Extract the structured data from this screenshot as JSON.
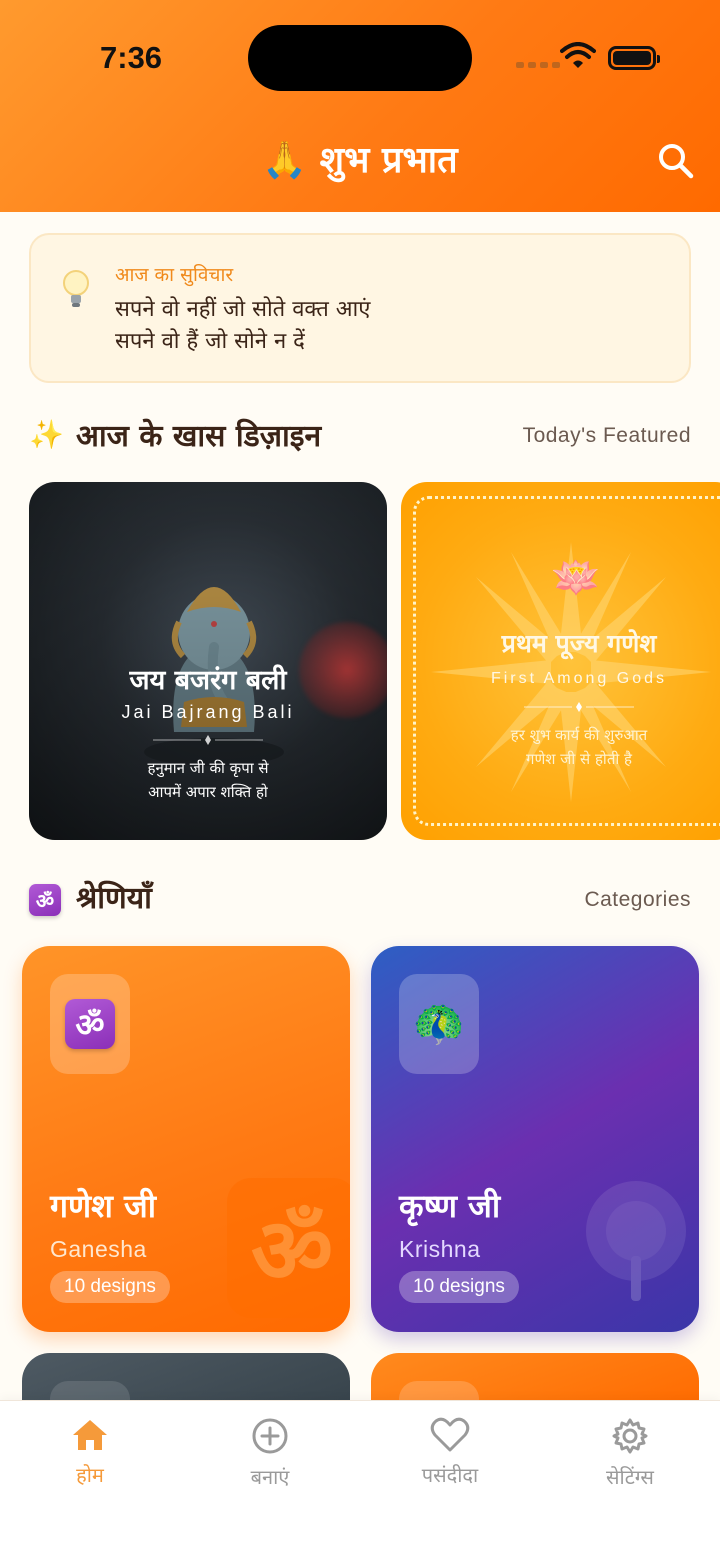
{
  "status": {
    "time": "7:36"
  },
  "header": {
    "title": "🙏 शुभ प्रभात"
  },
  "quote": {
    "label": "आज का सुविचार",
    "line1": "सपने वो नहीं जो सोते वक्त आएं",
    "line2": "सपने वो हैं जो सोने न दें"
  },
  "featured": {
    "icon": "✨",
    "title": "आज के खास डिज़ाइन",
    "subtitle": "Today's Featured",
    "cards": [
      {
        "title": "जय बजरंग बली",
        "subtitle": "Jai Bajrang Bali",
        "line1": "हनुमान जी की कृपा से",
        "line2": "आपमें अपार शक्ति हो"
      },
      {
        "title": "प्रथम पूज्य गणेश",
        "subtitle": "First Among Gods",
        "line1": "हर शुभ कार्य की शुरुआत",
        "line2": "गणेश जी से होती है",
        "emoji": "🪷"
      }
    ]
  },
  "categories": {
    "title": "श्रेणियाँ",
    "subtitle": "Categories",
    "om_symbol": "ॐ",
    "items": [
      {
        "name_hi": "गणेश जी",
        "name_en": "Ganesha",
        "count": "10 designs",
        "icon": "om-icon"
      },
      {
        "name_hi": "कृष्ण जी",
        "name_en": "Krishna",
        "count": "10 designs",
        "icon": "peacock-icon",
        "emoji": "🦚"
      }
    ]
  },
  "nav": {
    "items": [
      {
        "label": "होम",
        "icon": "home-icon",
        "active": true
      },
      {
        "label": "बनाएं",
        "icon": "add-circle-icon"
      },
      {
        "label": "पसंदीदा",
        "icon": "heart-icon"
      },
      {
        "label": "सेटिंग्स",
        "icon": "gear-icon"
      }
    ]
  },
  "colors": {
    "accent": "#ff7a14",
    "active_nav": "#f59a3a",
    "text": "#3b2417"
  }
}
